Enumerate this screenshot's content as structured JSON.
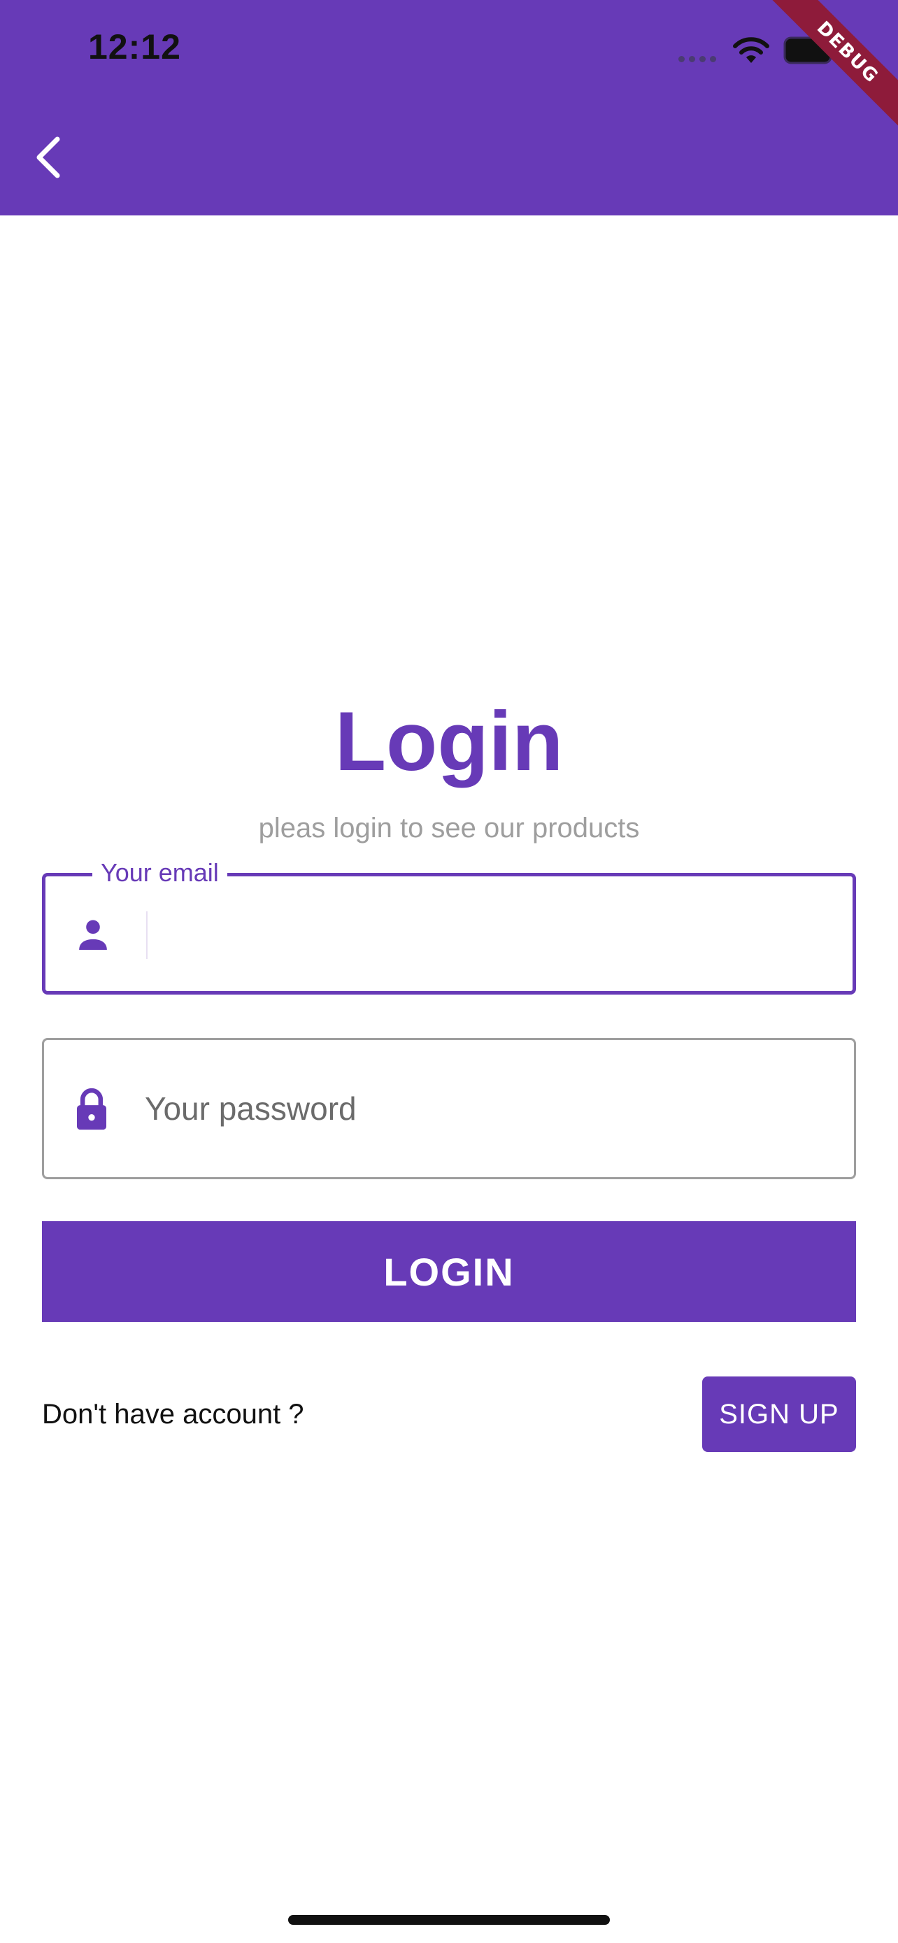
{
  "status_bar": {
    "time": "12:12"
  },
  "debug_banner": "DEBUG",
  "colors": {
    "primary": "#673AB7",
    "debug_ribbon": "#8E1B3A",
    "hint_gray": "#9E9E9E"
  },
  "icons": {
    "back": "chevron-left-icon",
    "email": "person-icon",
    "password": "lock-icon",
    "wifi": "wifi-icon",
    "battery": "battery-icon"
  },
  "page": {
    "title": "Login",
    "subtitle": "pleas login to see our products"
  },
  "email_field": {
    "label": "Your email",
    "value": ""
  },
  "password_field": {
    "placeholder": "Your password",
    "value": ""
  },
  "login_button": {
    "label": "LOGIN"
  },
  "signup": {
    "prompt": "Don't have account ?",
    "button_label": "SIGN UP"
  }
}
